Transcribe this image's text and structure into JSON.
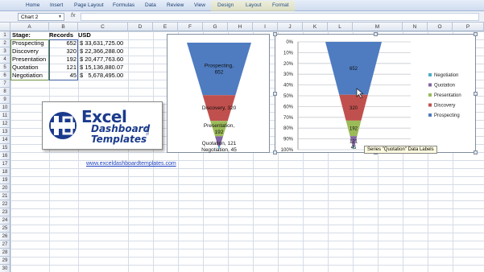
{
  "ribbon": {
    "tabs": [
      "Home",
      "Insert",
      "Page Layout",
      "Formulas",
      "Data",
      "Review",
      "View",
      "Design",
      "Layout",
      "Format"
    ]
  },
  "formula_bar": {
    "name_box": "Chart 2",
    "fx": "fx"
  },
  "columns": [
    "A",
    "B",
    "C",
    "D",
    "E",
    "F",
    "G",
    "H",
    "I",
    "J",
    "K",
    "L",
    "M",
    "N",
    "O",
    "P"
  ],
  "rows": [
    "1",
    "2",
    "3",
    "4",
    "5",
    "6",
    "7",
    "8",
    "9",
    "10",
    "11",
    "12",
    "13",
    "14",
    "15",
    "16",
    "17",
    "18",
    "19",
    "20",
    "21",
    "22",
    "23",
    "24",
    "25",
    "26",
    "27",
    "28",
    "29",
    "30"
  ],
  "sheet": {
    "headers": [
      "Stage:",
      "Records",
      "USD"
    ],
    "data": [
      {
        "stage": "Prospecting",
        "records": "652",
        "usd": "$ 33,631,725.00"
      },
      {
        "stage": "Discovery",
        "records": "320",
        "usd": "$ 22,366,288.00"
      },
      {
        "stage": "Presentation",
        "records": "192",
        "usd": "$ 20,477,763.60"
      },
      {
        "stage": "Quotation",
        "records": "121",
        "usd": "$ 15,136,880.07"
      },
      {
        "stage": "Negotiation",
        "records": "45",
        "usd": "$   5,678,495.00"
      }
    ],
    "link": "www.exceldashboardtemplates.com"
  },
  "logo": {
    "line1": "Excel",
    "line2": "Dashboard",
    "line3": "Templates",
    "suffix": ".com"
  },
  "chart_data": [
    {
      "type": "bar",
      "categories": [
        "Prospecting",
        "Discovery",
        "Presentation",
        "Quotation",
        "Negotiation"
      ],
      "values": [
        652,
        320,
        192,
        121,
        45
      ],
      "data_labels": [
        "Prospecting, 652",
        "Discovery, 320",
        "Presentation, 192",
        "Quotation, 121",
        "Negotiation, 45"
      ],
      "colors": [
        "#4f7cc0",
        "#c0504d",
        "#9bbb59",
        "#8064a2",
        "#4bacc6"
      ],
      "legend": "none"
    },
    {
      "type": "bar",
      "categories": [
        "Prospecting",
        "Discovery",
        "Presentation",
        "Quotation",
        "Negotiation"
      ],
      "values": [
        652,
        320,
        192,
        121,
        45
      ],
      "y_ticks": [
        "0%",
        "10%",
        "20%",
        "30%",
        "40%",
        "50%",
        "60%",
        "70%",
        "80%",
        "90%",
        "100%"
      ],
      "legend": "right",
      "legend_entries": [
        "Negotiation",
        "Quotation",
        "Presentation",
        "Discovery",
        "Prospecting"
      ],
      "colors": [
        "#4f7cc0",
        "#c0504d",
        "#9bbb59",
        "#8064a2",
        "#4bacc6"
      ],
      "grid": true
    }
  ],
  "tooltip": "Series \"Quotation\" Data Labels"
}
